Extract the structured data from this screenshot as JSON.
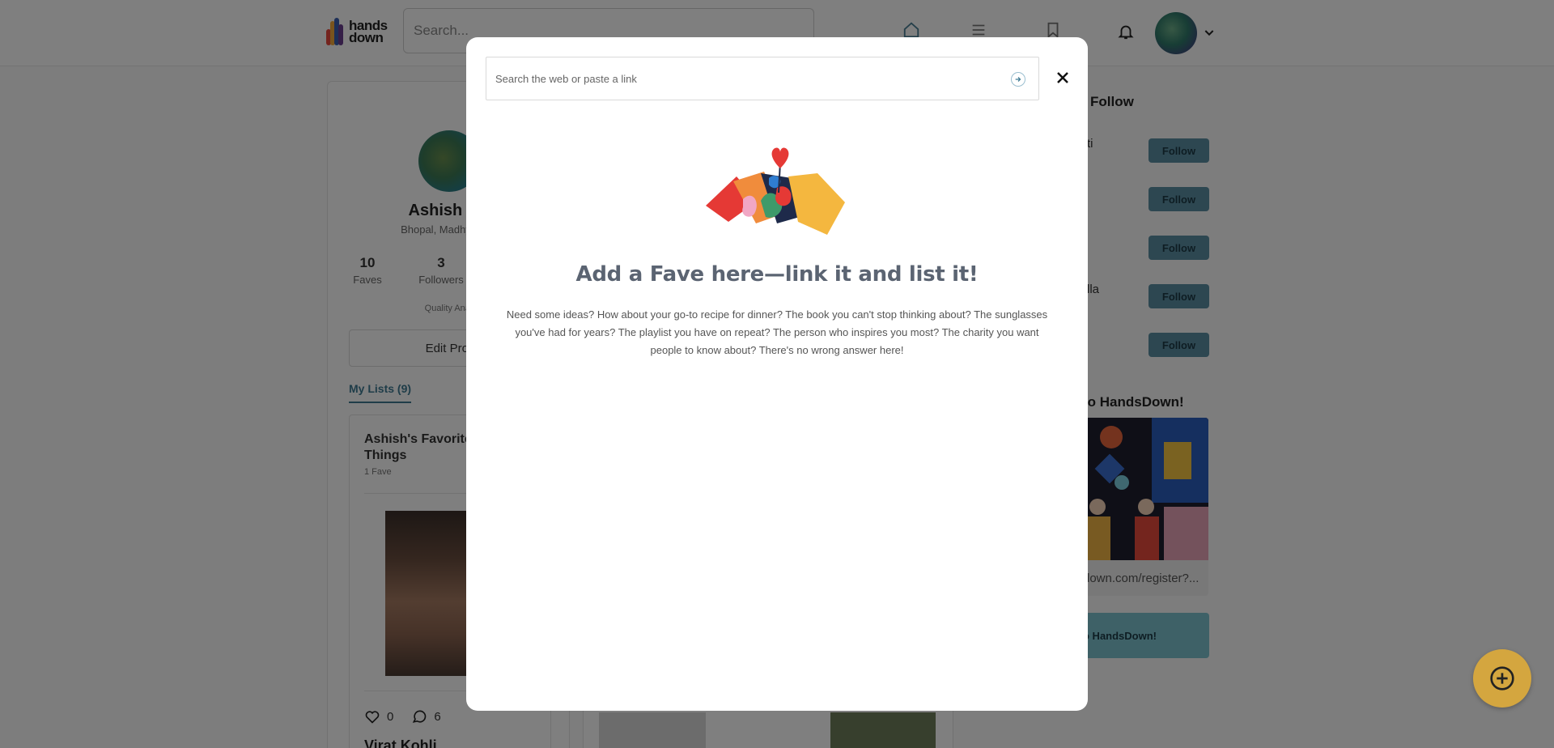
{
  "header": {
    "logo_line1": "hands",
    "logo_line2": "down",
    "search_placeholder": "Search..."
  },
  "profile": {
    "name": "Ashish Kh",
    "location": "Bhopal, Madhya Pra",
    "stats": [
      {
        "value": "10",
        "label": "Faves"
      },
      {
        "value": "3",
        "label": "Followers"
      }
    ],
    "role": "Quality Anal",
    "edit_label": "Edit Profi",
    "lists_tab": "My Lists (9)",
    "list_card": {
      "title": "Ashish's Favorite Things",
      "count": "1 Fave",
      "likes": "0",
      "comments": "6",
      "item_name": "Virat Kohli"
    }
  },
  "sidebar": {
    "follow_heading": "Follow",
    "suggestions": [
      {
        "name": "ti",
        "button": "Follow"
      },
      {
        "name": "",
        "button": "Follow"
      },
      {
        "name": "",
        "button": "Follow"
      },
      {
        "name": "lla",
        "button": "Follow"
      },
      {
        "name": "",
        "button": "Follow"
      }
    ],
    "promo_heading": "to HandsDown!",
    "promo_link": "down.com/register?...",
    "promo_button": "o HandsDown!"
  },
  "modal": {
    "search_placeholder": "Search the web or paste a link",
    "title": "Add a Fave here—link it and list it!",
    "description": "Need some ideas? How about your go-to recipe for dinner? The book you can't stop thinking about? The sunglasses you've had for years? The playlist you have on repeat? The person who inspires you most? The charity you want people to know about? There's no wrong answer here!"
  },
  "colors": {
    "accent": "#5b8fa3",
    "fab": "#d4a63f",
    "promo_button": "#7cc3cf",
    "title_text": "#5b6472"
  },
  "icons": {
    "nav": [
      "home-icon",
      "list-icon",
      "bookmark-icon"
    ],
    "notifications": "bell-icon",
    "modal_go": "arrow-right-circle-icon",
    "modal_close": "close-icon",
    "fab": "plus-circle-icon"
  }
}
